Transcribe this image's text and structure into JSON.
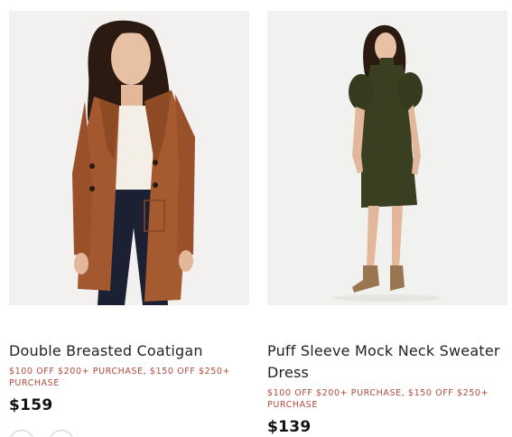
{
  "products": [
    {
      "name": "Double Breasted Coatigan",
      "promo": "$100 OFF $200+ PURCHASE, $150 OFF $250+ PURCHASE",
      "price": "$159",
      "image": "model wearing rust double breasted coatigan over cream top and dark jeans"
    },
    {
      "name": "Puff Sleeve Mock Neck Sweater Dress",
      "promo": "$100 OFF $200+ PURCHASE, $150 OFF $250+ PURCHASE",
      "price": "$139",
      "image": "model wearing olive puff sleeve mock neck sweater dress with tan ankle boots"
    }
  ],
  "colors": {
    "promo": "#b04a3c",
    "price": "#111111",
    "name": "#222222",
    "coat": "#a4582f",
    "dress": "#3b3f22"
  }
}
